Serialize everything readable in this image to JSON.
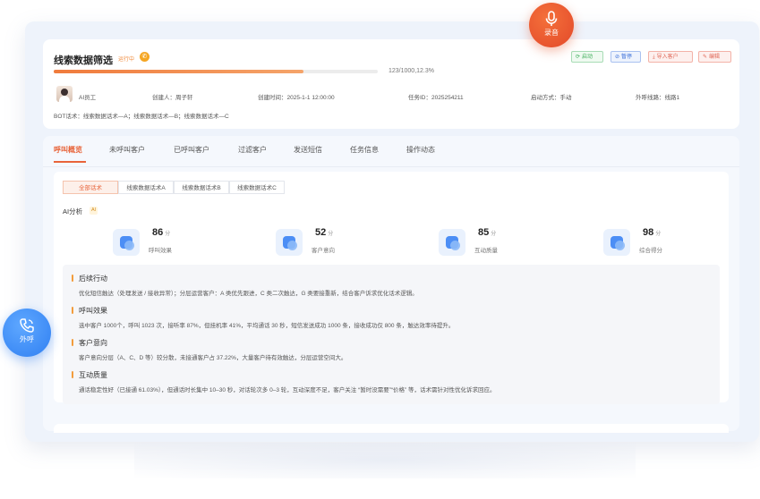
{
  "header": {
    "title": "线索数据筛选",
    "status": "运行中",
    "progress_text": "123/1000,12.3%",
    "progress_pct": 12.3,
    "buttons": {
      "start": "启动",
      "pause": "暂停",
      "import": "导入客户",
      "edit": "编辑"
    },
    "meta": {
      "agent": "AI员工",
      "creator": "创建人：周子轩",
      "created_at": "创建时间：2025-1-1 12:00:00",
      "task_id": "任务ID：2025254211",
      "start_mode": "启动方式：手动",
      "line": "外呼线路：线路1"
    },
    "bot_scripts": "BOT话术：线索数据话术—A；线索数据话术—B；线索数据话术—C"
  },
  "floating": {
    "record_label": "录音",
    "call_label": "外呼"
  },
  "tabs": [
    {
      "label": "呼叫概览"
    },
    {
      "label": "未呼叫客户"
    },
    {
      "label": "已呼叫客户"
    },
    {
      "label": "过滤客户"
    },
    {
      "label": "发送短信"
    },
    {
      "label": "任务信息"
    },
    {
      "label": "操作动态"
    }
  ],
  "script_tabs": [
    {
      "label": "全部话术"
    },
    {
      "label": "线索数据话术A"
    },
    {
      "label": "线索数据话术B"
    },
    {
      "label": "线索数据话术C"
    }
  ],
  "ai": {
    "label": "AI分析",
    "badge": "AI"
  },
  "metrics": [
    {
      "value": "86",
      "unit": "分",
      "label": "呼叫效果"
    },
    {
      "value": "52",
      "unit": "分",
      "label": "客户意向"
    },
    {
      "value": "85",
      "unit": "分",
      "label": "互动质量"
    },
    {
      "value": "98",
      "unit": "分",
      "label": "综合得分"
    }
  ],
  "analysis": [
    {
      "title": "后续行动",
      "body": "优化短信触达（处理发送 / 接收异常）；分层运营客户：A 类优先跟进，C 类二次触达，G 类要接重新，结合客户诉求优化话术逻辑。"
    },
    {
      "title": "呼叫效果",
      "body": "选中客户 1000个，呼叫 1023 次，接听率 87%，但挂机率 41%，平均通话 30 秒，短信发送成功 1000 条，接收成功仅 800 条，触达效率待提升。"
    },
    {
      "title": "客户意向",
      "body": "客户意向分层（A、C、D 等）较分散，未接通客户占 37.22%，大量客户待有效触达，分层运营空间大。"
    },
    {
      "title": "互动质量",
      "body": "通话稳定性好（已接通 61.03%），但通话时长集中 10–30 秒，对话轮次多 0–3 轮，互动深度不足，客户关注 “暂时没需要”“价格” 等，话术需针对性优化诉求回应。"
    }
  ]
}
